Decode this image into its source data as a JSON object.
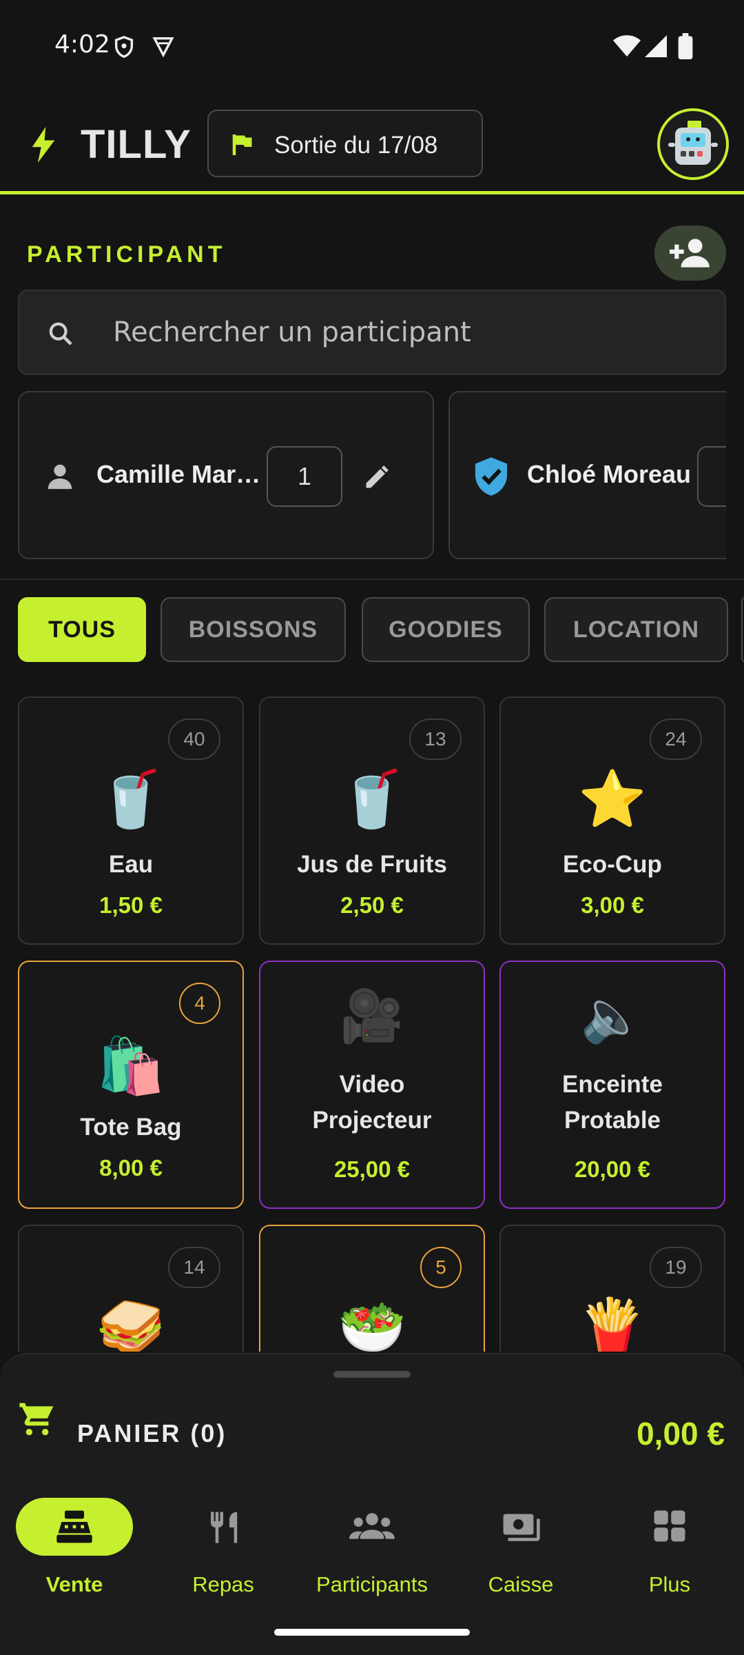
{
  "status_bar": {
    "time": "4:02",
    "icons": [
      "shield-icon",
      "vpn-icon",
      "wifi-icon",
      "signal-icon",
      "battery-icon"
    ]
  },
  "app_bar": {
    "brand": "TILLY",
    "event": "Sortie du 17/08",
    "accent": "#c6ef30"
  },
  "participant": {
    "section_title": "PARTICIPANT",
    "search_placeholder": "Rechercher un participant",
    "cards": [
      {
        "name": "Camille Mar…",
        "count": "1",
        "icon": "person-icon"
      },
      {
        "name": "Chloé Moreau",
        "count": "",
        "icon": "verified-shield-icon"
      }
    ]
  },
  "tabs": [
    "TOUS",
    "BOISSONS",
    "GOODIES",
    "LOCATION"
  ],
  "products": [
    {
      "name": "Eau",
      "price": "1,50 €",
      "stock": "40",
      "emoji": "🥤"
    },
    {
      "name": "Jus de Fruits",
      "price": "2,50 €",
      "stock": "13",
      "emoji": "🥤"
    },
    {
      "name": "Eco-Cup",
      "price": "3,00 €",
      "stock": "24",
      "emoji": "⭐"
    },
    {
      "name": "Tote Bag",
      "price": "8,00 €",
      "stock": "4",
      "emoji": "🛍️"
    },
    {
      "name_line1": "Video",
      "name_line2": "Projecteur",
      "price": "25,00 €",
      "emoji": "🎥"
    },
    {
      "name_line1": "Enceinte",
      "name_line2": "Protable",
      "price": "20,00 €",
      "emoji": "🔈"
    },
    {
      "stock": "14",
      "emoji": "🥪"
    },
    {
      "stock": "5",
      "emoji": "🥗"
    },
    {
      "stock": "19",
      "emoji": "🍟"
    }
  ],
  "cart": {
    "label": "PANIER (0)",
    "total": "0,00 €"
  },
  "nav": [
    {
      "label": "Vente",
      "icon": "cash-register-icon",
      "active": true
    },
    {
      "label": "Repas",
      "icon": "restaurant-icon"
    },
    {
      "label": "Participants",
      "icon": "group-icon"
    },
    {
      "label": "Caisse",
      "icon": "payments-icon"
    },
    {
      "label": "Plus",
      "icon": "grid-icon"
    }
  ]
}
